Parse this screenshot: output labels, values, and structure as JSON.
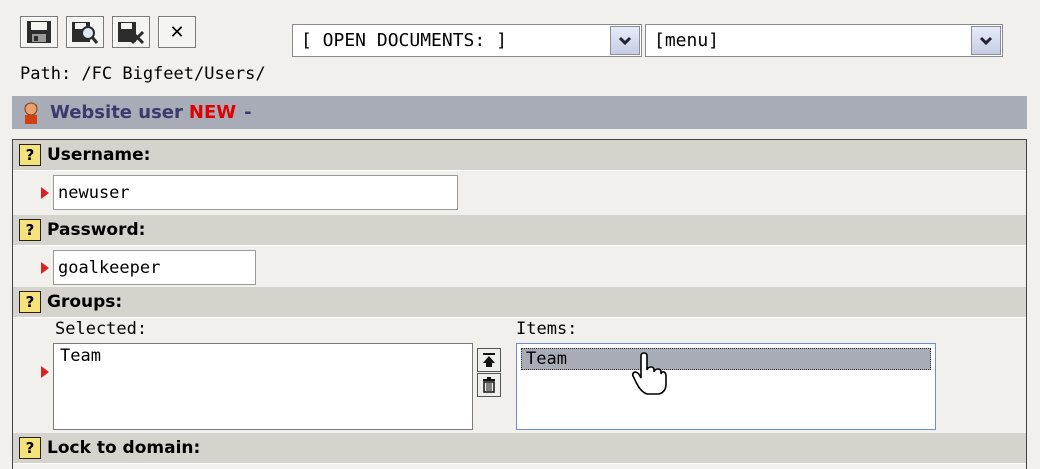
{
  "toolbar": {
    "buttons": [
      {
        "name": "save-icon"
      },
      {
        "name": "save-view-icon"
      },
      {
        "name": "save-close-icon"
      },
      {
        "name": "close-icon",
        "glyph": "✕"
      }
    ]
  },
  "selects": {
    "open_documents": "[ OPEN DOCUMENTS: ]",
    "menu": "[menu]"
  },
  "path": "Path: /FC Bigfeet/Users/",
  "header": {
    "title": "Website user",
    "badge": "NEW",
    "suffix": "-"
  },
  "form": {
    "username": {
      "label": "Username:",
      "value": "newuser"
    },
    "password": {
      "label": "Password:",
      "value": "goalkeeper"
    },
    "groups": {
      "label": "Groups:",
      "selected_label": "Selected:",
      "items_label": "Items:",
      "selected": [
        "Team"
      ],
      "items": [
        "Team"
      ]
    },
    "lock_to_domain": {
      "label": "Lock to domain:"
    }
  },
  "help_glyph": "?",
  "colors": {
    "header_bg": "#a8acb7",
    "label_bg": "#d6d3cc",
    "required_marker": "#e02020",
    "new_badge": "#e00000"
  }
}
